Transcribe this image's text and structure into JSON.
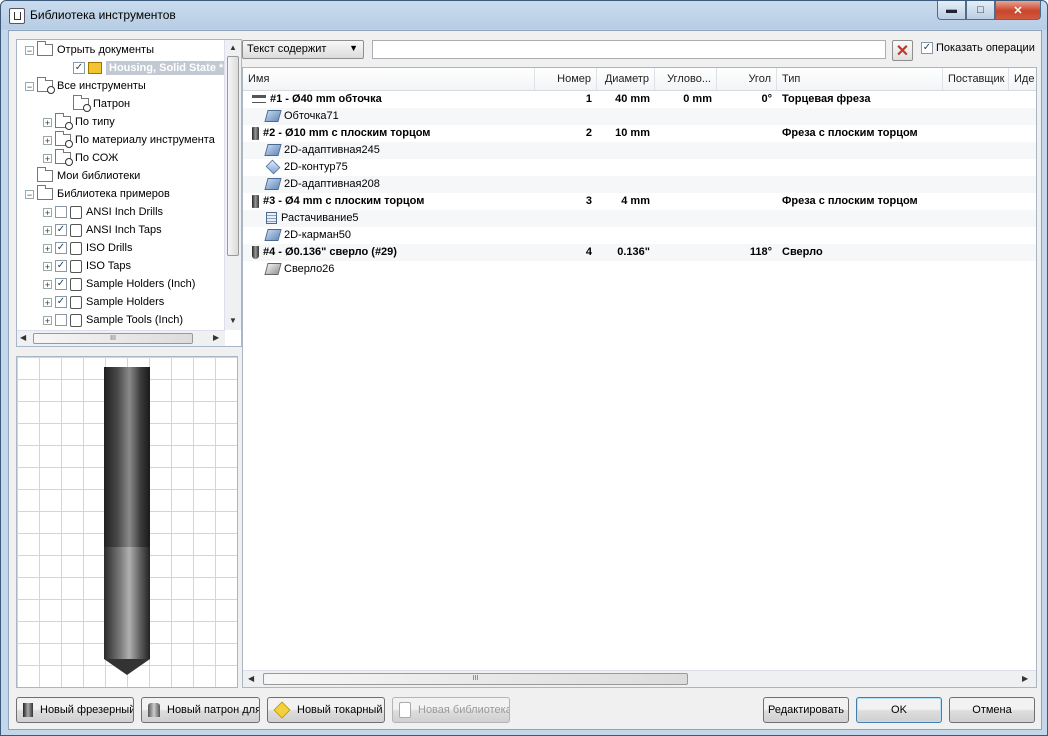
{
  "window": {
    "title": "Библиотека инструментов"
  },
  "titlebar_buttons": {
    "minimize": "▬",
    "maximize": "□",
    "close": "✕"
  },
  "tree": {
    "items": [
      {
        "label": "Отрыть документы",
        "expander": "−",
        "icon": "open-folder-icon"
      },
      {
        "label": "Housing, Solid State *",
        "checked": "✓",
        "icon": "part-document-icon"
      },
      {
        "label": "Все инструменты",
        "expander": "−",
        "icon": "search-folder-icon"
      },
      {
        "label": "Патрон",
        "icon": "search-folder-icon"
      },
      {
        "label": "По типу",
        "expander": "+",
        "icon": "search-folder-icon"
      },
      {
        "label": "По материалу инструмента",
        "expander": "+",
        "icon": "search-folder-icon"
      },
      {
        "label": "По СОЖ",
        "expander": "+",
        "icon": "search-folder-icon"
      },
      {
        "label": "Мои библиотеки",
        "icon": "folder-icon"
      },
      {
        "label": "Библиотека примеров",
        "expander": "−",
        "icon": "folder-icon"
      },
      {
        "label": "ANSI Inch Drills",
        "expander": "+",
        "checked": ""
      },
      {
        "label": "ANSI Inch Taps",
        "expander": "+",
        "checked": "✓"
      },
      {
        "label": "ISO Drills",
        "expander": "+",
        "checked": "✓"
      },
      {
        "label": "ISO Taps",
        "expander": "+",
        "checked": "✓"
      },
      {
        "label": "Sample Holders (Inch)",
        "expander": "+",
        "checked": "✓"
      },
      {
        "label": "Sample Holders",
        "expander": "+",
        "checked": "✓"
      },
      {
        "label": "Sample Tools (Inch)",
        "expander": "+",
        "checked": ""
      }
    ]
  },
  "filter": {
    "mode": "Текст содержит",
    "search_value": "",
    "show_operations_label": "Показать операции",
    "show_operations_checked": "✓",
    "clear_glyph": "✕"
  },
  "grid": {
    "columns": [
      "Имя",
      "Номер",
      "Диаметр",
      "Углово...",
      "Угол",
      "Тип",
      "Поставщик",
      "Иде"
    ],
    "rows": [
      {
        "kind": "tool",
        "icon": "face-mill-icon",
        "name": "#1 - Ø40 mm обточка",
        "number": "1",
        "diameter": "40 mm",
        "corner": "0 mm",
        "angle": "0°",
        "type": "Торцевая фреза"
      },
      {
        "kind": "op",
        "icon": "facing-op-icon",
        "name": "Обточка71"
      },
      {
        "kind": "tool",
        "icon": "end-mill-icon",
        "name": "#2 - Ø10 mm с плоским торцом",
        "number": "2",
        "diameter": "10 mm",
        "corner": "",
        "angle": "",
        "type": "Фреза с плоским торцом"
      },
      {
        "kind": "op",
        "icon": "adaptive-op-icon",
        "name": "2D-адаптивная245"
      },
      {
        "kind": "op",
        "icon": "contour-op-icon",
        "name": "2D-контур75"
      },
      {
        "kind": "op",
        "icon": "adaptive-op-icon",
        "name": "2D-адаптивная208"
      },
      {
        "kind": "tool",
        "icon": "end-mill-icon",
        "name": "#3 - Ø4 mm с плоским торцом",
        "number": "3",
        "diameter": "4 mm",
        "corner": "",
        "angle": "",
        "type": "Фреза с плоским торцом"
      },
      {
        "kind": "op",
        "icon": "bore-op-icon",
        "name": "Растачивание5"
      },
      {
        "kind": "op",
        "icon": "pocket-op-icon",
        "name": "2D-карман50"
      },
      {
        "kind": "tool",
        "icon": "drill-icon",
        "name": "#4 - Ø0.136\" сверло (#29)",
        "number": "4",
        "diameter": "0.136\"",
        "corner": "",
        "angle": "118°",
        "type": "Сверло"
      },
      {
        "kind": "op",
        "icon": "drill-op-icon",
        "name": "Сверло26"
      }
    ]
  },
  "scroll_glyphs": {
    "up": "▲",
    "down": "▼",
    "left": "◀",
    "right": "▶",
    "grip": "III"
  },
  "buttons": {
    "new_mill": "Новый фрезерный",
    "new_holder": "Новый патрон для",
    "new_turning": "Новый токарный",
    "new_library": "Новая библиотека",
    "edit": "Редактировать",
    "ok": "OK",
    "cancel": "Отмена"
  }
}
